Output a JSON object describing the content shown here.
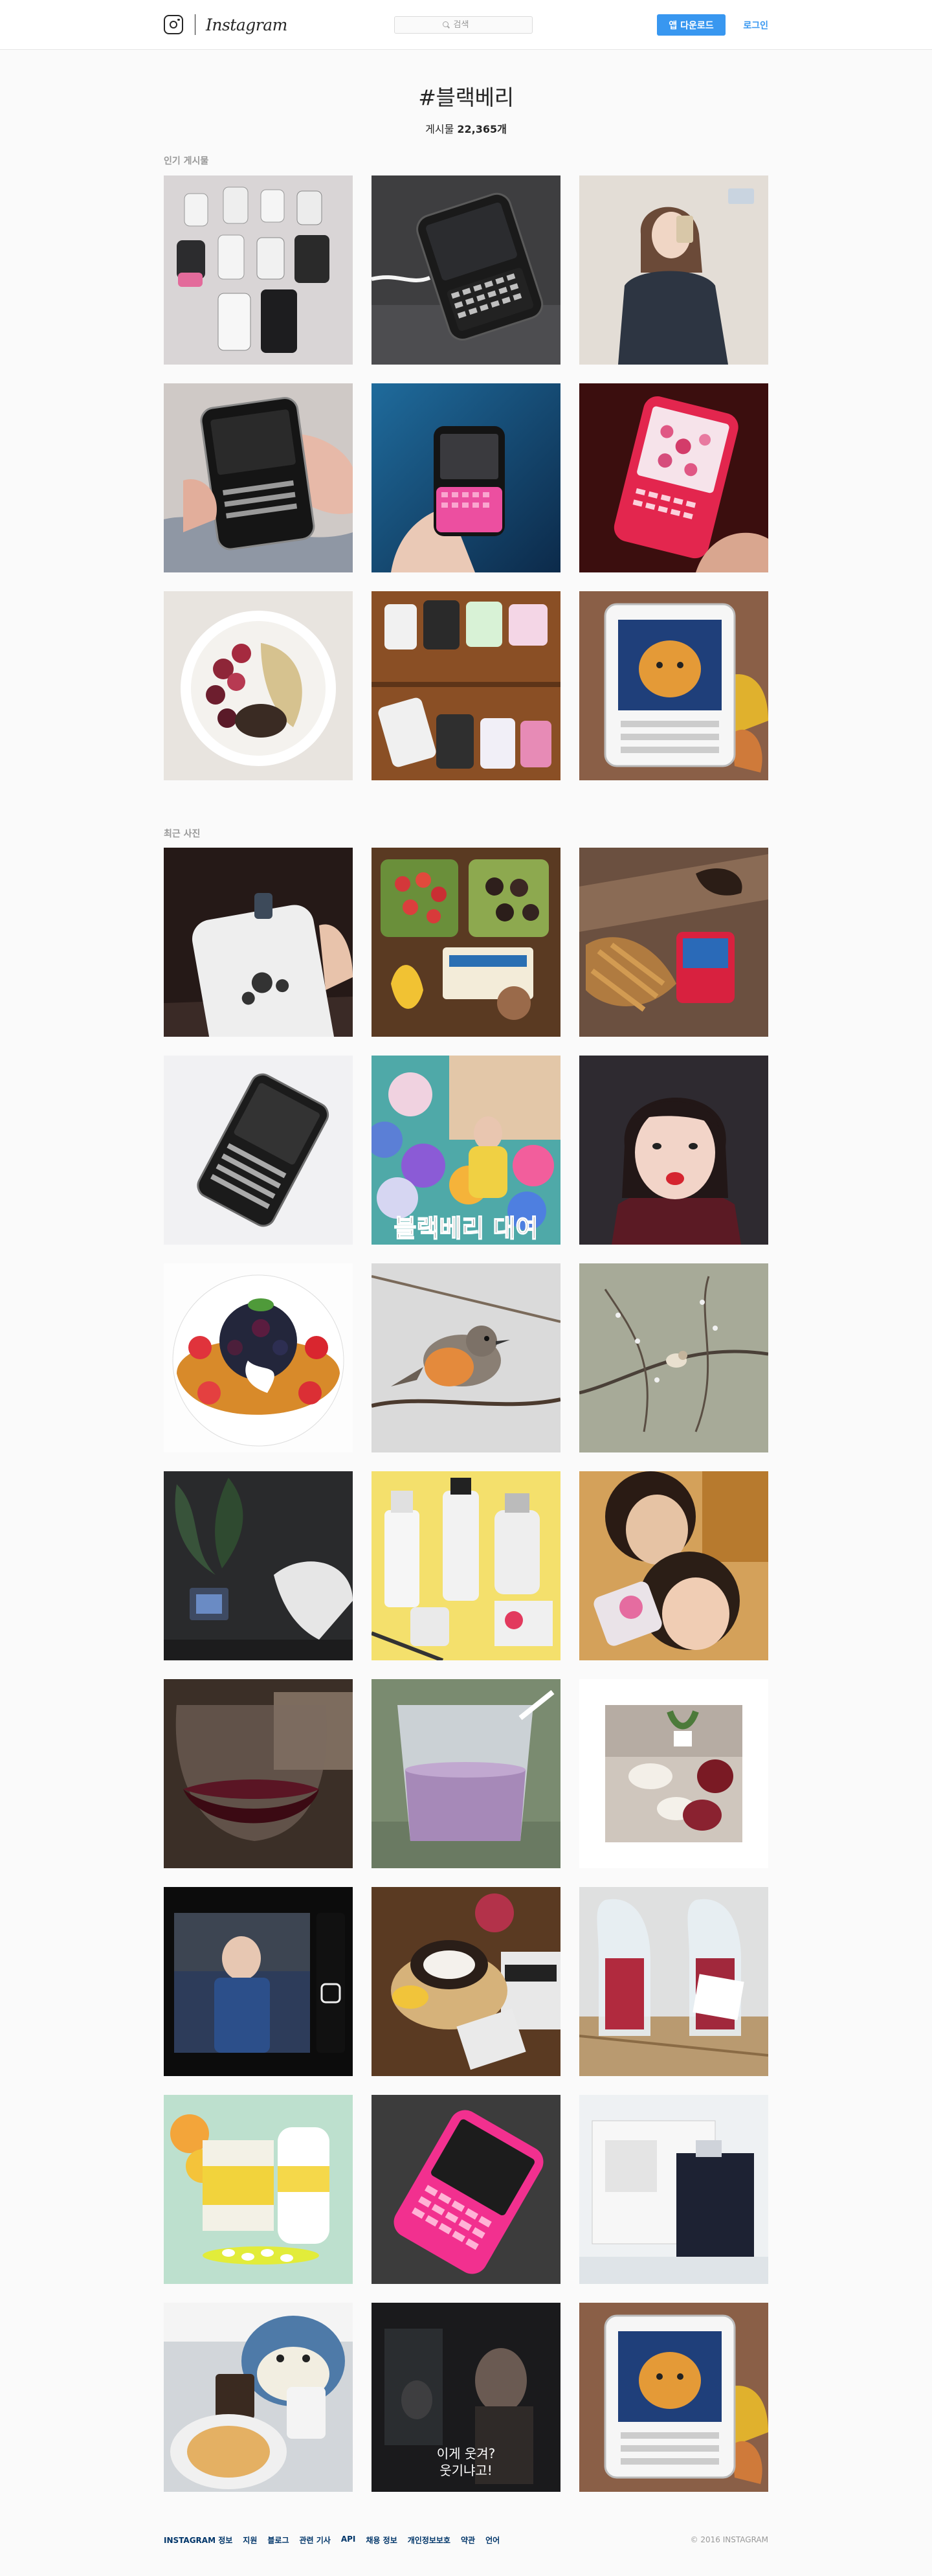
{
  "header": {
    "brand": "Instagram",
    "search_placeholder": "검색",
    "app_download": "앱 다운로드",
    "login": "로그인"
  },
  "tag": {
    "title": "#블랙베리",
    "count_label": "게시물",
    "count_value": "22,365개"
  },
  "sections": {
    "top": "인기 게시물",
    "recent": "최근 사진"
  },
  "top_posts": [
    "phones-collection-photo",
    "phone-charging-photo",
    "mirror-selfie-photo",
    "hand-holding-phone-photo",
    "pink-keyboard-phone-photo",
    "red-phone-photo",
    "berry-bowl-photo",
    "phone-collection-table-photo",
    "phone-character-photo"
  ],
  "recent_posts": [
    "white-phone-photo",
    "lunch-box-photo",
    "red-phone-table-photo",
    "black-phone-photo",
    "balloon-photo",
    "selfie-photo",
    "waffle-photo",
    "bird-photo",
    "bird-branch-photo",
    "plant-photo",
    "cosmetics-photo",
    "couple-photo",
    "wine-glass-photo",
    "smoothie-photo",
    "table-photo",
    "phone-screen-photo",
    "sandwich-photo",
    "drinks-photo",
    "vitamin-photo",
    "pink-phone-photo",
    "product-box-photo",
    "cafe-photo",
    "movie-still-photo",
    "phone-character-photo-2"
  ],
  "captions": {
    "balloon_text": "블랙베리 대여",
    "movie_line1": "이게 웃겨?",
    "movie_line2": "웃기냐고!"
  },
  "footer": {
    "links": [
      "INSTAGRAM 정보",
      "지원",
      "블로그",
      "관련 기사",
      "API",
      "채용 정보",
      "개인정보보호",
      "약관",
      "언어"
    ],
    "copyright": "© 2016 INSTAGRAM"
  },
  "colors": {
    "accent": "#3897f0",
    "footer_link": "#003569",
    "muted": "#999999",
    "background": "#fafafa"
  }
}
